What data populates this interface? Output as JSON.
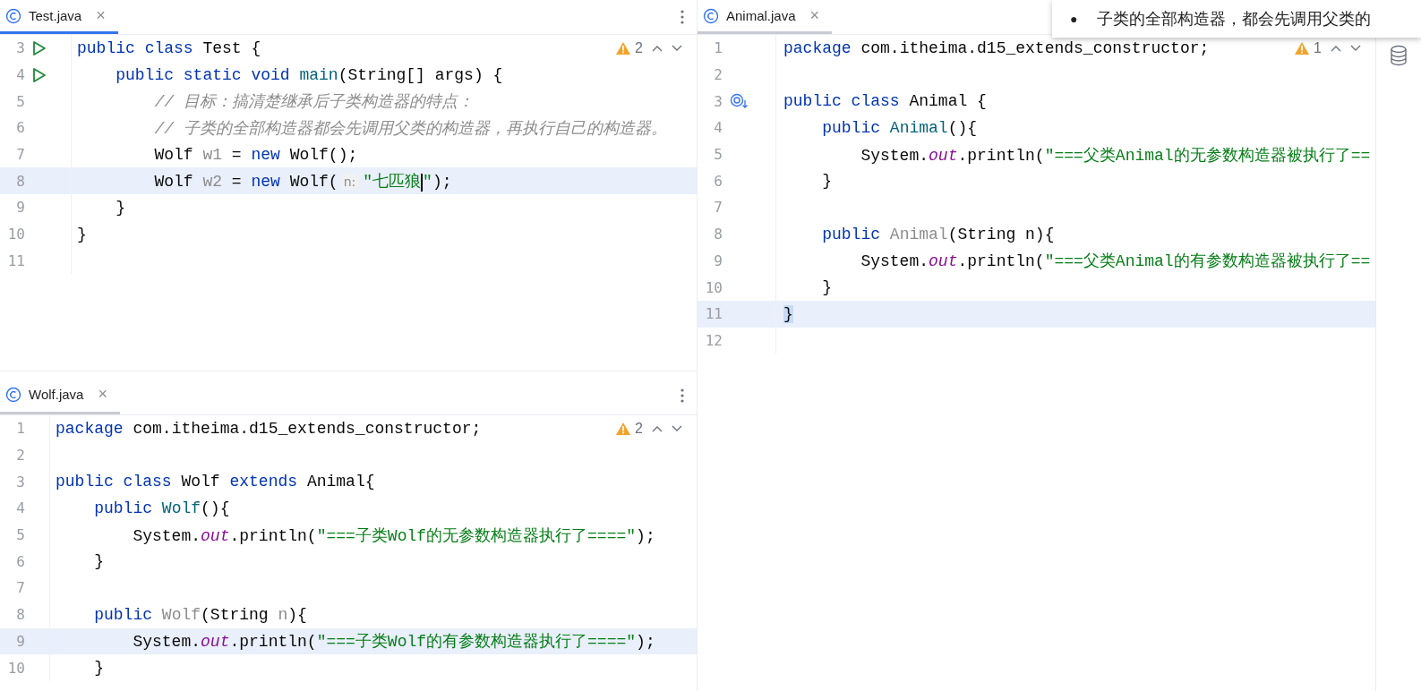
{
  "panes": [
    {
      "tab": {
        "label": "Test.java",
        "focused": true,
        "close": "×"
      },
      "warnings": "2",
      "lines": [
        {
          "num": "3",
          "gutter_icon": {
            "kind": "run"
          },
          "current": false,
          "tokens": [
            {
              "t": "public ",
              "kind": "kw"
            },
            {
              "t": "class ",
              "kind": "kw"
            },
            {
              "t": "Test {",
              "kind": "plain"
            }
          ]
        },
        {
          "num": "4",
          "gutter_icon": {
            "kind": "run"
          },
          "current": false,
          "tokens": [
            {
              "t": "    public static void ",
              "kind": "kw"
            },
            {
              "t": "main",
              "kind": "method"
            },
            {
              "t": "(String[] args) {",
              "kind": "plain"
            }
          ]
        },
        {
          "num": "5",
          "current": false,
          "tokens": [
            {
              "t": "        // 目标：搞清楚继承后子类构造器的特点：",
              "kind": "comment"
            }
          ]
        },
        {
          "num": "6",
          "current": false,
          "tokens": [
            {
              "t": "        // 子类的全部构造器都会先调用父类的构造器，再执行自己的构造器。",
              "kind": "comment"
            }
          ]
        },
        {
          "num": "7",
          "current": false,
          "tokens": [
            {
              "t": "        Wolf ",
              "kind": "plain"
            },
            {
              "t": "w1",
              "kind": "unused"
            },
            {
              "t": " = ",
              "kind": "plain"
            },
            {
              "t": "new",
              "kind": "kw"
            },
            {
              "t": " Wolf();",
              "kind": "plain"
            }
          ]
        },
        {
          "num": "8",
          "current": true,
          "tokens": [
            {
              "t": "        Wolf ",
              "kind": "plain"
            },
            {
              "t": "w2",
              "kind": "unused"
            },
            {
              "t": " = ",
              "kind": "plain"
            },
            {
              "t": "new",
              "kind": "kw"
            },
            {
              "t": " Wolf(",
              "kind": "plain"
            },
            {
              "t": "n:",
              "kind": "hint"
            },
            {
              "t": "\"七匹狼",
              "kind": "str",
              "caret": true
            },
            {
              "t": "\"",
              "kind": "str"
            },
            {
              "t": ");",
              "kind": "plain"
            }
          ]
        },
        {
          "num": "9",
          "current": false,
          "tokens": [
            {
              "t": "    }",
              "kind": "plain"
            }
          ]
        },
        {
          "num": "10",
          "current": false,
          "tokens": [
            {
              "t": "}",
              "kind": "plain"
            }
          ]
        },
        {
          "num": "11",
          "current": false
        }
      ]
    },
    {
      "tab": {
        "label": "Wolf.java",
        "focused": false,
        "close": "×"
      },
      "warnings": "2",
      "lines": [
        {
          "num": "1",
          "current": false,
          "tokens": [
            {
              "t": "package ",
              "kind": "kw"
            },
            {
              "t": "com.itheima.d15_extends_constructor;",
              "kind": "plain"
            }
          ]
        },
        {
          "num": "2",
          "current": false
        },
        {
          "num": "3",
          "current": false,
          "tokens": [
            {
              "t": "public class ",
              "kind": "kw"
            },
            {
              "t": "Wolf ",
              "kind": "plain"
            },
            {
              "t": "extends ",
              "kind": "kw"
            },
            {
              "t": "Animal{",
              "kind": "plain"
            }
          ]
        },
        {
          "num": "4",
          "current": false,
          "tokens": [
            {
              "t": "    public ",
              "kind": "kw"
            },
            {
              "t": "Wolf",
              "kind": "method"
            },
            {
              "t": "(){",
              "kind": "plain"
            }
          ]
        },
        {
          "num": "5",
          "current": false,
          "tokens": [
            {
              "t": "        System.",
              "kind": "plain"
            },
            {
              "t": "out",
              "kind": "field"
            },
            {
              "t": ".println(",
              "kind": "plain"
            },
            {
              "t": "\"===子类Wolf的无参数构造器执行了====\"",
              "kind": "str"
            },
            {
              "t": ");",
              "kind": "plain"
            }
          ]
        },
        {
          "num": "6",
          "current": false,
          "tokens": [
            {
              "t": "    }",
              "kind": "plain"
            }
          ]
        },
        {
          "num": "7",
          "current": false
        },
        {
          "num": "8",
          "current": false,
          "tokens": [
            {
              "t": "    public ",
              "kind": "kw"
            },
            {
              "t": "Wolf",
              "kind": "unused"
            },
            {
              "t": "(String ",
              "kind": "plain"
            },
            {
              "t": "n",
              "kind": "unused"
            },
            {
              "t": "){",
              "kind": "plain"
            }
          ]
        },
        {
          "num": "9",
          "current": true,
          "tokens": [
            {
              "t": "        System.",
              "kind": "plain"
            },
            {
              "t": "out",
              "kind": "field"
            },
            {
              "t": ".println(",
              "kind": "plain"
            },
            {
              "t": "\"===子类Wolf的有参数构造器执行了====\"",
              "kind": "str"
            },
            {
              "t": ");",
              "kind": "plain"
            }
          ]
        },
        {
          "num": "10",
          "current": false,
          "tokens": [
            {
              "t": "    }",
              "kind": "plain"
            }
          ]
        }
      ]
    },
    {
      "tab": {
        "label": "Animal.java",
        "focused": false,
        "close": "×"
      },
      "warnings": "1",
      "lines": [
        {
          "num": "1",
          "current": false,
          "tokens": [
            {
              "t": "package ",
              "kind": "kw"
            },
            {
              "t": "com.itheima.d15_extends_constructor;",
              "kind": "plain"
            }
          ]
        },
        {
          "num": "2",
          "current": false
        },
        {
          "num": "3",
          "gutter_icon": {
            "kind": "override"
          },
          "current": false,
          "tokens": [
            {
              "t": "public class ",
              "kind": "kw"
            },
            {
              "t": "Animal {",
              "kind": "plain"
            }
          ]
        },
        {
          "num": "4",
          "current": false,
          "tokens": [
            {
              "t": "    public ",
              "kind": "kw"
            },
            {
              "t": "Animal",
              "kind": "method"
            },
            {
              "t": "(){",
              "kind": "plain"
            }
          ]
        },
        {
          "num": "5",
          "current": false,
          "tokens": [
            {
              "t": "        System.",
              "kind": "plain"
            },
            {
              "t": "out",
              "kind": "field"
            },
            {
              "t": ".println(",
              "kind": "plain"
            },
            {
              "t": "\"===父类Animal的无参数构造器被执行了==",
              "kind": "str"
            }
          ]
        },
        {
          "num": "6",
          "current": false,
          "tokens": [
            {
              "t": "    }",
              "kind": "plain"
            }
          ]
        },
        {
          "num": "7",
          "current": false
        },
        {
          "num": "8",
          "current": false,
          "tokens": [
            {
              "t": "    public ",
              "kind": "kw"
            },
            {
              "t": "Animal",
              "kind": "unused"
            },
            {
              "t": "(String n){",
              "kind": "plain"
            }
          ]
        },
        {
          "num": "9",
          "current": false,
          "tokens": [
            {
              "t": "        System.",
              "kind": "plain"
            },
            {
              "t": "out",
              "kind": "field"
            },
            {
              "t": ".println(",
              "kind": "plain"
            },
            {
              "t": "\"===父类Animal的有参数构造器被执行了==",
              "kind": "str"
            }
          ]
        },
        {
          "num": "10",
          "current": false,
          "tokens": [
            {
              "t": "    }",
              "kind": "plain"
            }
          ]
        },
        {
          "num": "11",
          "current": true,
          "tokens": [
            {
              "t": "}",
              "kind": "match"
            }
          ]
        },
        {
          "num": "12",
          "current": false
        }
      ]
    }
  ],
  "tooltip": {
    "bullet": "●",
    "text": "子类的全部构造器，都会先调用父类的"
  }
}
